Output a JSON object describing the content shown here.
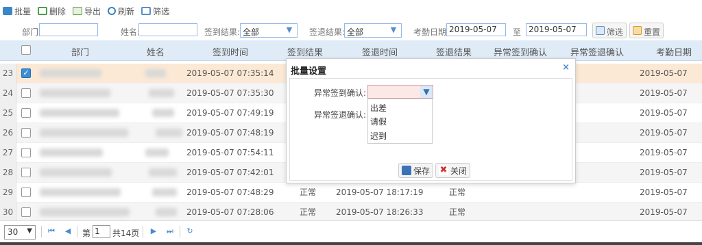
{
  "toolbar": {
    "batch": "批量",
    "delete": "删除",
    "export": "导出",
    "refresh": "刷新",
    "filter": "筛选"
  },
  "filters": {
    "dept_label": "部门:",
    "name_label": "姓名:",
    "signin_result_label": "签到结果:",
    "signin_result_value": "全部",
    "signout_result_label": "签退结果:",
    "signout_result_value": "全部",
    "date_label": "考勤日期:",
    "date_from": "2019-05-07",
    "date_to_label": "至",
    "date_to": "2019-05-07",
    "filter_btn": "筛选",
    "reset_btn": "重置"
  },
  "columns": [
    "部门",
    "姓名",
    "签到时间",
    "签到结果",
    "签退时间",
    "签退结果",
    "异常签到确认",
    "异常签退确认",
    "考勤日期"
  ],
  "rows": [
    {
      "num": "23",
      "checked": true,
      "signin": "2019-05-07 07:35:14",
      "signin_result": "",
      "signout": "",
      "signout_result": "",
      "date": "2019-05-07"
    },
    {
      "num": "24",
      "checked": false,
      "signin": "2019-05-07 07:35:30",
      "signin_result": "",
      "signout": "",
      "signout_result": "",
      "date": "2019-05-07"
    },
    {
      "num": "25",
      "checked": false,
      "signin": "2019-05-07 07:49:19",
      "signin_result": "",
      "signout": "",
      "signout_result": "",
      "date": "2019-05-07"
    },
    {
      "num": "26",
      "checked": false,
      "signin": "2019-05-07 07:48:19",
      "signin_result": "",
      "signout": "",
      "signout_result": "",
      "date": "2019-05-07"
    },
    {
      "num": "27",
      "checked": false,
      "signin": "2019-05-07 07:54:11",
      "signin_result": "",
      "signout": "",
      "signout_result": "",
      "date": "2019-05-07"
    },
    {
      "num": "28",
      "checked": false,
      "signin": "2019-05-07 07:42:01",
      "signin_result": "",
      "signout": "",
      "signout_result": "",
      "date": "2019-05-07"
    },
    {
      "num": "29",
      "checked": false,
      "signin": "2019-05-07 07:48:29",
      "signin_result": "正常",
      "signout": "2019-05-07 18:17:19",
      "signout_result": "正常",
      "date": "2019-05-07"
    },
    {
      "num": "30",
      "checked": false,
      "signin": "2019-05-07 07:28:06",
      "signin_result": "正常",
      "signout": "2019-05-07 18:26:33",
      "signout_result": "正常",
      "date": "2019-05-07"
    }
  ],
  "pager": {
    "page_size": "30",
    "page_label": "第",
    "page_value": "1",
    "total_label": "共14页"
  },
  "modal": {
    "title": "批量设置",
    "close": "×",
    "signin_confirm_label": "异常签到确认:",
    "signout_confirm_label": "异常签退确认:",
    "options": [
      "出差",
      "请假",
      "迟到"
    ],
    "save": "保存",
    "cancel": "关闭"
  }
}
